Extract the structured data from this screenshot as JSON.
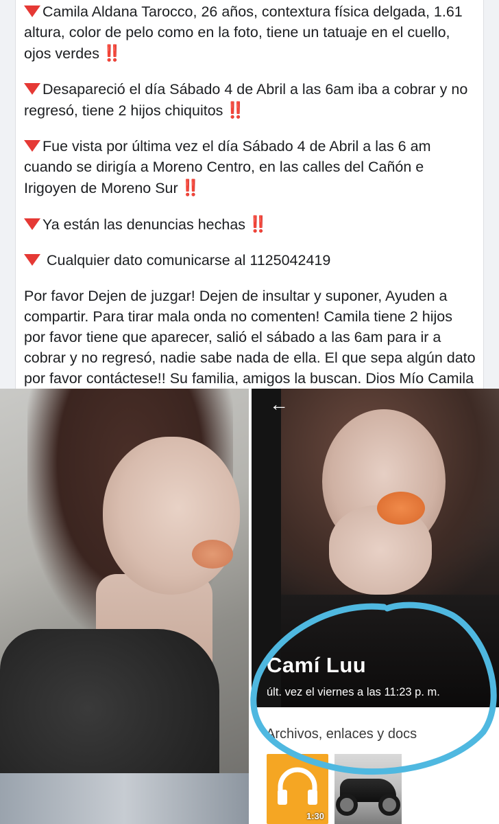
{
  "post": {
    "paragraphs": [
      {
        "icon": "red-triangle-icon",
        "text": "Camila Aldana Tarocco, 26 años, contextura física delgada, 1.61 altura, color de pelo como en la foto, tiene un tatuaje en el cuello, ojos verdes",
        "emphasis": "‼️"
      },
      {
        "icon": "red-triangle-icon",
        "text": "Desapareció el día Sábado 4 de Abril a las 6am iba a cobrar y no regresó, tiene 2 hijos chiquitos",
        "emphasis": "‼️"
      },
      {
        "icon": "red-triangle-icon",
        "text": "Fue vista por última vez el día Sábado 4 de Abril a las 6 am cuando se dirigía a Moreno Centro, en las calles del Cañón e Irigoyen de Moreno Sur",
        "emphasis": "‼️"
      },
      {
        "icon": "red-triangle-icon",
        "text": "Ya están las denuncias hechas",
        "emphasis": "‼️"
      },
      {
        "icon": "red-triangle-icon",
        "text": " Cualquier dato comunicarse al 1125042419",
        "emphasis": ""
      },
      {
        "icon": "",
        "text": "Por favor Dejen de juzgar! Dejen de insultar y suponer, Ayuden a compartir. Para tirar mala onda no comenten! Camila tiene 2 hijos por favor tiene que aparecer, salió el sábado a las 6am para ir a cobrar y no regresó,  nadie sabe nada de ella. El que sepa algún dato por favor contáctese!! Su familia, amigos la buscan. Dios Mío Camila Dios te guarde!",
        "emphasis": ""
      }
    ]
  },
  "chat_screenshot": {
    "back_icon": "back-arrow-icon",
    "back_glyph": "←",
    "contact_name": "Camí Luu",
    "last_seen": "últ. vez el viernes a las 11:23 p. m.",
    "files_label": "Archivos, enlaces y docs",
    "audio_duration": "1:30",
    "highlight_color": "#4fb8e0"
  },
  "colors": {
    "triangle": "#e53935",
    "text": "#1c1e21"
  }
}
